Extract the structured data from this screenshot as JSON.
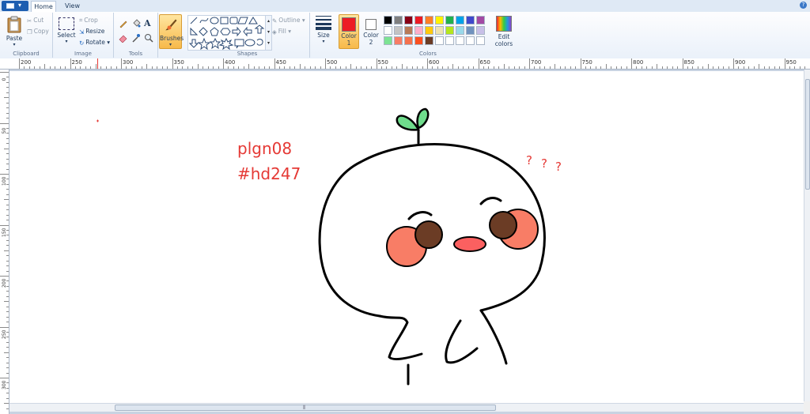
{
  "tabs": {
    "home": "Home",
    "view": "View"
  },
  "help_icon": "help-icon",
  "clipboard": {
    "paste": "Paste",
    "cut": "Cut",
    "copy": "Copy",
    "label": "Clipboard"
  },
  "image": {
    "select": "Select",
    "crop": "Crop",
    "resize": "Resize",
    "rotate": "Rotate",
    "label": "Image"
  },
  "tools": {
    "label": "Tools",
    "text_tool": "A"
  },
  "brushes": {
    "label": "Brushes"
  },
  "shapes": {
    "outline": "Outline",
    "fill": "Fill",
    "label": "Shapes"
  },
  "size": {
    "label": "Size"
  },
  "color1": {
    "label": "Color",
    "num": "1",
    "value": "#ed1c24"
  },
  "color2": {
    "label": "Color",
    "num": "2",
    "value": "#ffffff"
  },
  "colors": {
    "label": "Colors",
    "edit_label": "Edit",
    "edit_label2": "colors",
    "row1": [
      "#000000",
      "#7f7f7f",
      "#880015",
      "#ed1c24",
      "#ff7f27",
      "#fff200",
      "#22b14c",
      "#00a2e8",
      "#3f48cc",
      "#a349a4"
    ],
    "row2": [
      "#ffffff",
      "#c3c3c3",
      "#b97a57",
      "#ffaec9",
      "#ffc90e",
      "#efe4b0",
      "#b5e61d",
      "#99d9ea",
      "#7092be",
      "#c8bfe7"
    ],
    "row3": [
      "#7ce393",
      "#f87d66",
      "#f5714d",
      "#fb4f1f",
      "#6b3c25",
      "#ffffff",
      "#ffffff",
      "#ffffff",
      "#ffffff",
      "#ffffff"
    ]
  },
  "ruler": {
    "h_labels": [
      "200",
      "250",
      "300",
      "350",
      "400",
      "450",
      "500",
      "550",
      "600",
      "650",
      "700",
      "750",
      "800",
      "850",
      "900",
      "950"
    ],
    "v_labels": [
      "0",
      "50",
      "100",
      "150",
      "200",
      "250",
      "300"
    ]
  },
  "drawing": {
    "line1": "plgn08",
    "line2": "#hd247",
    "q1": "?",
    "q2": "?",
    "q3": "?"
  }
}
